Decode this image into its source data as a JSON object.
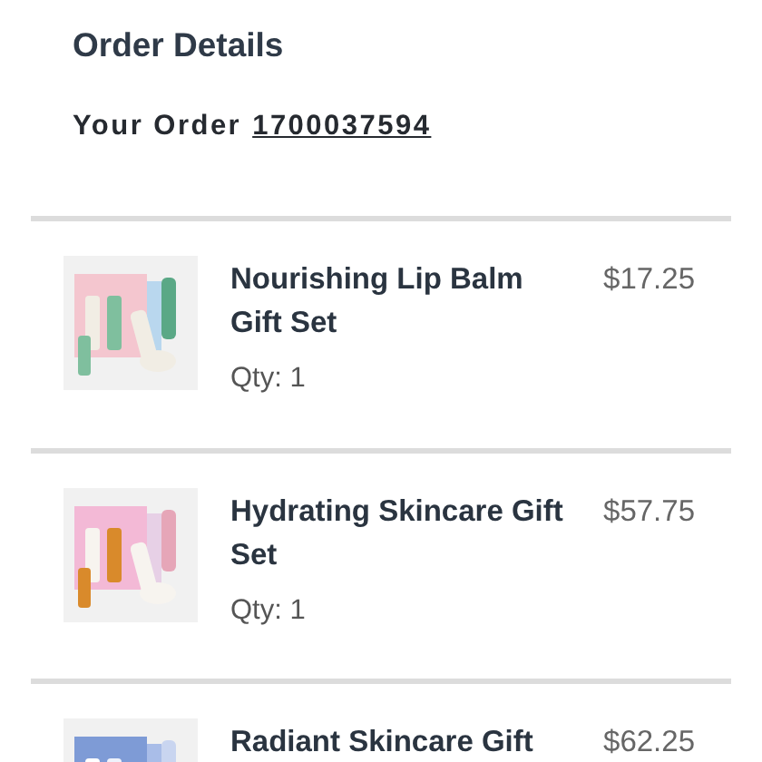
{
  "title": "Order Details",
  "order": {
    "label": "Your Order",
    "number": "1700037594"
  },
  "items": [
    {
      "kind": "picture",
      "name": "Nourishing Lip Balm Gift Set",
      "price": "$17.25",
      "qty": "Qty: 1"
    },
    {
      "kind": "picture",
      "name": "Hydrating Skincare Gift Set",
      "price": "$57.75",
      "qty": "Qty: 1"
    },
    {
      "kind": "picture",
      "name": "Radiant Skincare Gift",
      "price": "$62.25"
    }
  ]
}
